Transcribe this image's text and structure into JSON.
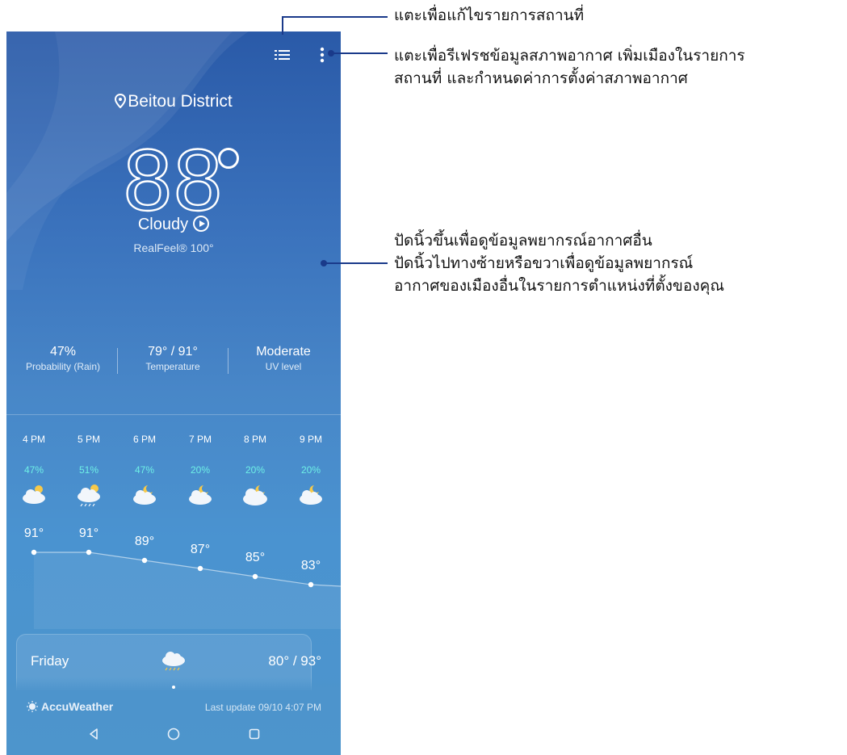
{
  "annotations": {
    "menu_list": "แตะเพื่อแก้ไขรายการสถานที่",
    "more_line1": "แตะเพื่อรีเฟรชข้อมูลสภาพอากาศ เพิ่มเมืองในรายการ",
    "more_line2": "สถานที่ และกำหนดค่าการตั้งค่าสภาพอากาศ",
    "swipe_line1": "ปัดนิ้วขึ้นเพื่อดูข้อมูลพยากรณ์อากาศอื่น",
    "swipe_line2": "ปัดนิ้วไปทางซ้ายหรือขวาเพื่อดูข้อมูลพยากรณ์",
    "swipe_line3": "อากาศของเมืองอื่นในรายการตำแหน่งที่ตั้งของคุณ"
  },
  "header": {
    "location": "Beitou District",
    "list_icon": "list-icon",
    "more_icon": "more-vert-icon"
  },
  "current": {
    "temperature": "88",
    "condition": "Cloudy",
    "realfeel": "RealFeel® 100°"
  },
  "stats": [
    {
      "value": "47%",
      "label": "Probability (Rain)"
    },
    {
      "value": "79° / 91°",
      "label": "Temperature"
    },
    {
      "value": "Moderate",
      "label": "UV level"
    }
  ],
  "hourly": [
    {
      "time": "4 PM",
      "prob": "47%",
      "temp": "91°",
      "icon": "cloud-sun-icon",
      "value": 91
    },
    {
      "time": "5 PM",
      "prob": "51%",
      "temp": "91°",
      "icon": "cloud-sun-rain-icon",
      "value": 91
    },
    {
      "time": "6 PM",
      "prob": "47%",
      "temp": "89°",
      "icon": "cloud-moon-icon",
      "value": 89
    },
    {
      "time": "7 PM",
      "prob": "20%",
      "temp": "87°",
      "icon": "cloud-moon-icon",
      "value": 87
    },
    {
      "time": "8 PM",
      "prob": "20%",
      "temp": "85°",
      "icon": "cloud-moon-icon",
      "value": 85
    },
    {
      "time": "9 PM",
      "prob": "20%",
      "temp": "83°",
      "icon": "cloud-moon-icon",
      "value": 83
    }
  ],
  "daily": {
    "day": "Friday",
    "temp": "80° / 93°",
    "icon": "cloud-rain-icon"
  },
  "footer": {
    "brand": "AccuWeather",
    "last_update": "Last update 09/10 4:07 PM"
  },
  "colors": {
    "accent_prob": "#6ef0e6",
    "callout_line": "#1a3a8a"
  }
}
